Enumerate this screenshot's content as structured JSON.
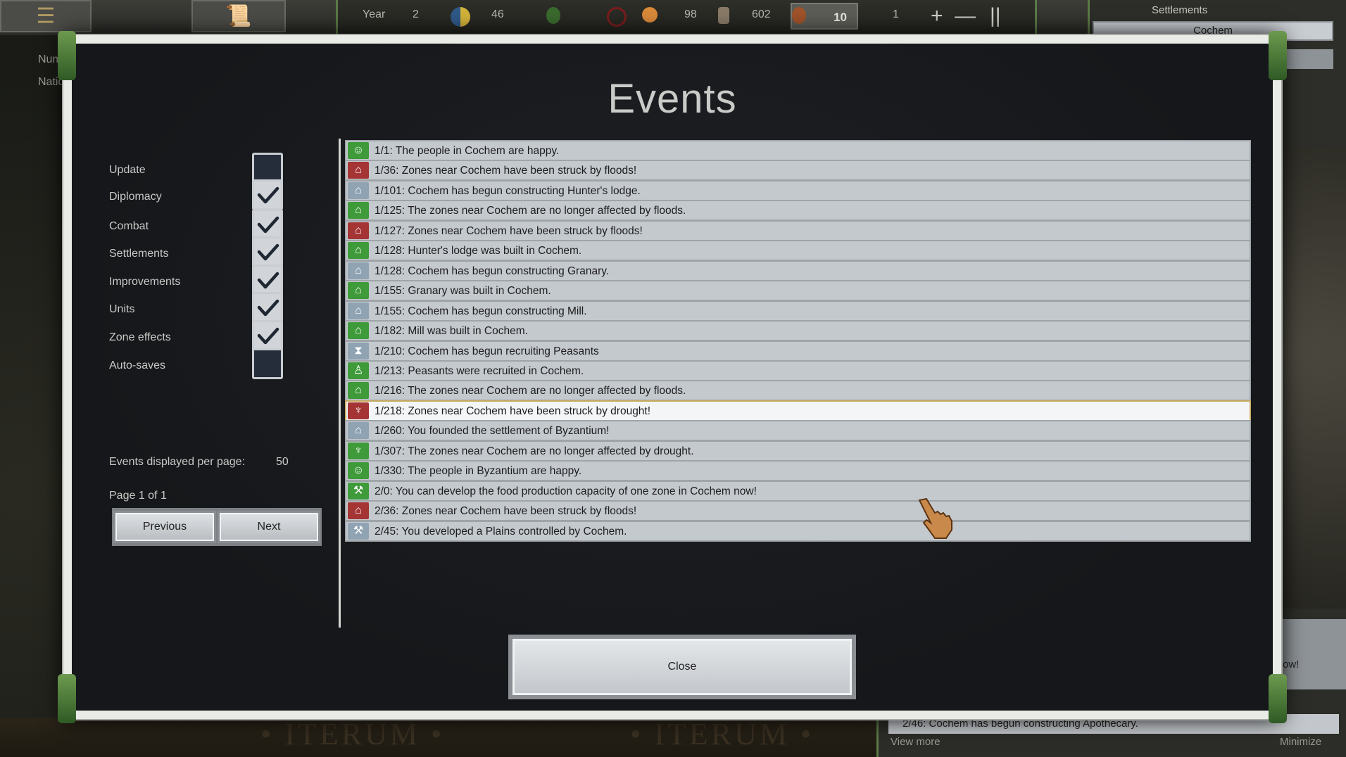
{
  "topbar": {
    "year_label": "Year",
    "year_value": "2",
    "food": "46",
    "happiness": "98",
    "population": "602",
    "gold": "10",
    "units": "1",
    "zoom_in": "+",
    "zoom_out": "—",
    "pause": "||"
  },
  "settlements_panel": {
    "title": "Settlements",
    "items": [
      "Cochem"
    ]
  },
  "side_labels": [
    "Num",
    "Natio"
  ],
  "log_panel": {
    "partial_text": "ow!",
    "row": "2/46: Cochem has begun constructing Apothecary.",
    "view_more": "View more",
    "minimize": "Minimize"
  },
  "background_text": [
    "• ITERUM •",
    "• ITERUM •"
  ],
  "modal": {
    "title": "Events",
    "filters": [
      {
        "label": "Update",
        "checked": false
      },
      {
        "label": "Diplomacy",
        "checked": true
      },
      {
        "label": "Combat",
        "checked": true
      },
      {
        "label": "Settlements",
        "checked": true
      },
      {
        "label": "Improvements",
        "checked": true
      },
      {
        "label": "Units",
        "checked": true
      },
      {
        "label": "Zone effects",
        "checked": true
      },
      {
        "label": "Auto-saves",
        "checked": false
      }
    ],
    "events_per_page_label": "Events displayed per page:",
    "events_per_page_value": "50",
    "page_text": "Page 1 of 1",
    "previous_label": "Previous",
    "next_label": "Next",
    "close_label": "Close",
    "events": [
      {
        "text": "1/1: The people in Cochem are happy.",
        "icon": "happy-face-icon",
        "color": "#3f9a3a"
      },
      {
        "text": "1/36: Zones near Cochem have been struck by floods!",
        "icon": "flood-icon",
        "color": "#a53434"
      },
      {
        "text": "1/101: Cochem has begun constructing Hunter's lodge.",
        "icon": "construction-icon",
        "color": "#8fa3b3"
      },
      {
        "text": "1/125: The zones near Cochem are no longer affected by floods.",
        "icon": "flood-icon",
        "color": "#3f9a3a"
      },
      {
        "text": "1/127: Zones near Cochem have been struck by floods!",
        "icon": "flood-icon",
        "color": "#a53434"
      },
      {
        "text": "1/128: Hunter's lodge was built in Cochem.",
        "icon": "building-icon",
        "color": "#3f9a3a"
      },
      {
        "text": "1/128: Cochem has begun constructing Granary.",
        "icon": "construction-icon",
        "color": "#8fa3b3"
      },
      {
        "text": "1/155: Granary was built in Cochem.",
        "icon": "building-icon",
        "color": "#3f9a3a"
      },
      {
        "text": "1/155: Cochem has begun constructing Mill.",
        "icon": "construction-icon",
        "color": "#8fa3b3"
      },
      {
        "text": "1/182: Mill was built in Cochem.",
        "icon": "building-icon",
        "color": "#3f9a3a"
      },
      {
        "text": "1/210: Cochem has begun recruiting Peasants",
        "icon": "recruit-hourglass-icon",
        "color": "#8fa3b3"
      },
      {
        "text": "1/213: Peasants were recruited in Cochem.",
        "icon": "peasant-icon",
        "color": "#3f9a3a"
      },
      {
        "text": "1/216: The zones near Cochem are no longer affected by floods.",
        "icon": "flood-icon",
        "color": "#3f9a3a"
      },
      {
        "text": "1/218: Zones near Cochem have been struck by drought!",
        "icon": "drought-icon",
        "color": "#a53434"
      },
      {
        "text": "1/260: You founded the settlement of Byzantium!",
        "icon": "settlement-icon",
        "color": "#8fa3b3"
      },
      {
        "text": "1/307: The zones near Cochem are no longer affected by drought.",
        "icon": "drought-icon",
        "color": "#3f9a3a"
      },
      {
        "text": "1/330: The people in Byzantium are happy.",
        "icon": "happy-face-icon",
        "color": "#3f9a3a"
      },
      {
        "text": "2/0: You can develop the food production capacity of one zone in Cochem now!",
        "icon": "hammer-icon",
        "color": "#3f9a3a"
      },
      {
        "text": "2/36: Zones near Cochem have been struck by floods!",
        "icon": "flood-icon",
        "color": "#a53434"
      },
      {
        "text": "2/45: You developed a Plains controlled by Cochem.",
        "icon": "hammer-icon",
        "color": "#8fa3b3"
      }
    ],
    "hover_index": 13
  }
}
